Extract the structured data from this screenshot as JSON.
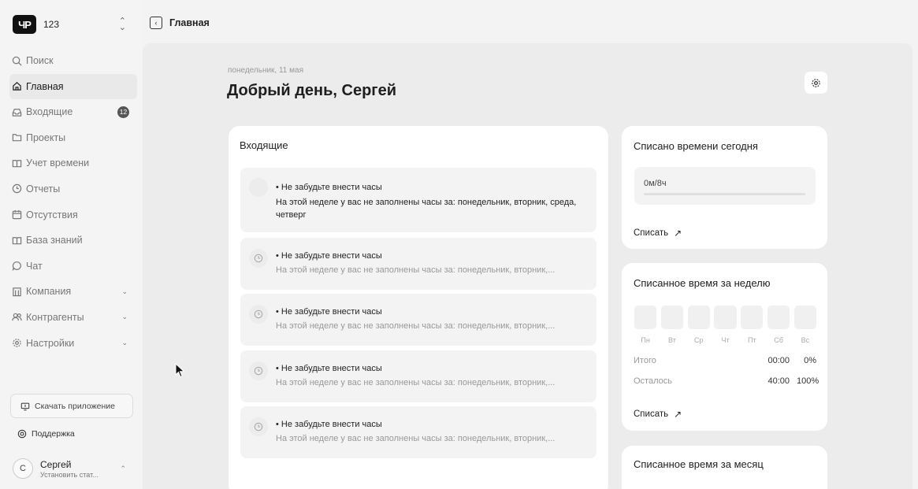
{
  "sidebar": {
    "org": {
      "logo": "ЧР",
      "name": "123"
    },
    "nav": [
      {
        "label": "Поиск",
        "icon": "search-icon"
      },
      {
        "label": "Главная",
        "icon": "home-icon",
        "active": true
      },
      {
        "label": "Входящие",
        "icon": "inbox-icon",
        "badge": "12"
      },
      {
        "label": "Проекты",
        "icon": "folder-icon"
      },
      {
        "label": "Учет времени",
        "icon": "book-icon"
      },
      {
        "label": "Отчеты",
        "icon": "clock-icon"
      },
      {
        "label": "Отсутствия",
        "icon": "calendar-icon"
      },
      {
        "label": "База знаний",
        "icon": "book-open-icon"
      },
      {
        "label": "Чат",
        "icon": "chat-icon"
      },
      {
        "label": "Компания",
        "icon": "building-icon",
        "expandable": true
      },
      {
        "label": "Контрагенты",
        "icon": "users-icon",
        "expandable": true
      },
      {
        "label": "Настройки",
        "icon": "gear-icon",
        "expandable": true
      }
    ],
    "download_label": "Скачать приложение",
    "support_label": "Поддержка",
    "user": {
      "initial": "С",
      "name": "Сергей",
      "status": "Установить стат..."
    }
  },
  "topbar": {
    "title": "Главная"
  },
  "main": {
    "date": "понедельник, 11 мая",
    "greeting": "Добрый день, Сергей",
    "inbox": {
      "title": "Входящие",
      "messages": [
        {
          "title": "• Не забудьте внести часы",
          "body": "На этой неделе у вас не заполнены часы за: понедельник, вторник, среда, четверг"
        },
        {
          "title": "• Не забудьте внести часы",
          "body": "На этой неделе у вас не заполнены часы за: понедельник, вторник,..."
        },
        {
          "title": "• Не забудьте внести часы",
          "body": "На этой неделе у вас не заполнены часы за: понедельник, вторник,..."
        },
        {
          "title": "• Не забудьте внести часы",
          "body": "На этой неделе у вас не заполнены часы за: понедельник, вторник,..."
        },
        {
          "title": "• Не забудьте внести часы",
          "body": "На этой неделе у вас не заполнены часы за: понедельник, вторник,..."
        }
      ]
    },
    "today": {
      "title": "Списано времени сегодня",
      "value": "0м/8ч",
      "progress": 0,
      "link": "Списать",
      "link_icon": "↗"
    },
    "week": {
      "title": "Списанное время за неделю",
      "days": [
        "Пн",
        "Вт",
        "Ср",
        "Чт",
        "Пт",
        "Сб",
        "Вс"
      ],
      "total": {
        "label": "Итого",
        "time": "00:00",
        "pct": "0%"
      },
      "remaining": {
        "label": "Осталось",
        "time": "40:00",
        "pct": "100%"
      },
      "link": "Списать",
      "link_icon": "↗"
    },
    "month": {
      "title": "Списанное время за месяц"
    }
  }
}
